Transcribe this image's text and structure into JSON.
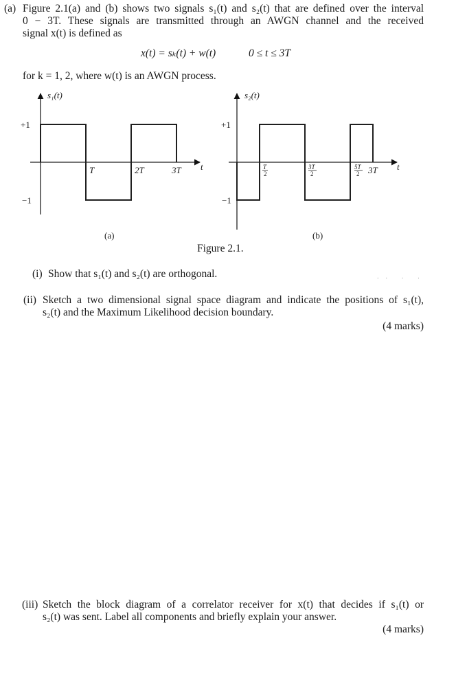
{
  "part_a": {
    "label": "(a)",
    "lines": [
      "Figure 2.1(a) and (b) shows two signals s₁(t) and s₂(t) that are defined over the interval",
      "0 − 3T.  These signals are transmitted through an AWGN channel and the received",
      "signal x(t) is defined as"
    ],
    "equation": "x(t) = sₖ(t) + w(t)",
    "equation_range": "0 ≤ t ≤ 3T",
    "after_equation": "for k = 1, 2, where w(t) is an AWGN process."
  },
  "figure": {
    "caption": "Figure 2.1.",
    "panels": [
      {
        "id": "a",
        "panel_label": "(a)",
        "y_axis_label": "s₁(t)",
        "x_axis_label": "t",
        "y_ticks": [
          "+1",
          "−1"
        ],
        "x_ticks": [
          {
            "value": 1,
            "label": "T"
          },
          {
            "value": 2,
            "label": "2T"
          },
          {
            "value": 3,
            "label": "3T"
          }
        ],
        "segments": [
          {
            "t_start": 0,
            "t_end": 1,
            "level": 1
          },
          {
            "t_start": 1,
            "t_end": 2,
            "level": -1
          },
          {
            "t_start": 2,
            "t_end": 3,
            "level": 1
          }
        ]
      },
      {
        "id": "b",
        "panel_label": "(b)",
        "y_axis_label": "s₂(t)",
        "x_axis_label": "t",
        "y_ticks": [
          "+1",
          "−1"
        ],
        "x_ticks": [
          {
            "value": 0.5,
            "label_num": "T",
            "label_den": "2"
          },
          {
            "value": 1.5,
            "label_num": "3T",
            "label_den": "2"
          },
          {
            "value": 2.5,
            "label_num": "5T",
            "label_den": "2"
          },
          {
            "value": 3,
            "label": "3T"
          }
        ],
        "segments": [
          {
            "t_start": 0,
            "t_end": 0.5,
            "level": -1
          },
          {
            "t_start": 0.5,
            "t_end": 1.5,
            "level": 1
          },
          {
            "t_start": 1.5,
            "t_end": 2.5,
            "level": -1
          },
          {
            "t_start": 2.5,
            "t_end": 3,
            "level": 1
          }
        ]
      }
    ]
  },
  "questions": [
    {
      "label": "(i)",
      "lines": [
        "Show that s₁(t) and s₂(t) are orthogonal."
      ],
      "marks": ""
    },
    {
      "label": "(ii)",
      "lines": [
        "Sketch a two dimensional signal space diagram and indicate the positions of s₁(t),",
        "s₂(t) and the Maximum Likelihood decision boundary."
      ],
      "marks": "(4 marks)"
    },
    {
      "label": "(iii)",
      "lines": [
        "Sketch the block diagram of a correlator receiver for x(t) that decides if s₁(t) or",
        "s₂(t) was sent. Label all components and briefly explain your answer."
      ],
      "marks": "(4 marks)"
    }
  ],
  "artifact_marks": "˙˙  ˙  ˙"
}
